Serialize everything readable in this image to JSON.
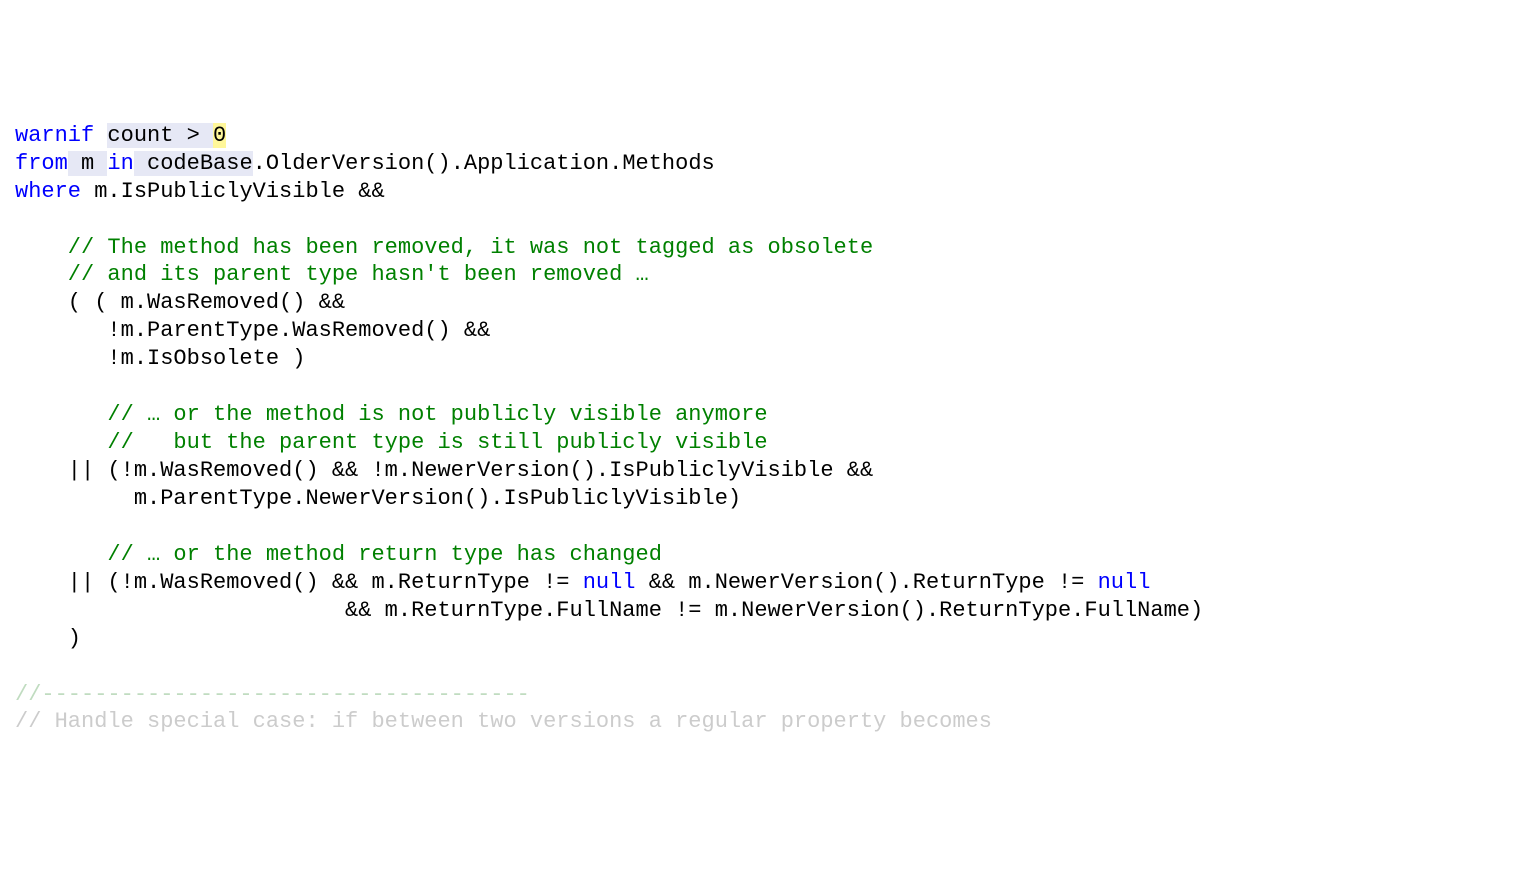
{
  "code": {
    "l01_kw_warnif": "warnif",
    "l01_txt_sp": " ",
    "l01_sel_count": "count ",
    "l01_sel_gt": "> ",
    "l01_hl_zero": "0",
    "l02_kw_from": "from",
    "l02_kw_in": "in",
    "l02_sel_m": " m ",
    "l02_sel_codebase": " codeBase",
    "l02_txt_rest": ".OlderVersion().Application.Methods",
    "l03_kw_where": "where",
    "l03_txt_rest": " m.IsPubliclyVisible &&",
    "l05_cm": "    // The method has been removed, it was not tagged as obsolete",
    "l06_cm": "    // and its parent type hasn't been removed …",
    "l07_txt": "    ( ( m.WasRemoved() && ",
    "l08_txt": "       !m.ParentType.WasRemoved() &&",
    "l09_txt": "       !m.IsObsolete )",
    "l11_cm": "       // … or the method is not publicly visible anymore",
    "l12_cm": "       //   but the parent type is still publicly visible",
    "l13_txt": "    || (!m.WasRemoved() && !m.NewerVersion().IsPubliclyVisible && ",
    "l14_txt": "         m.ParentType.NewerVersion().IsPubliclyVisible)",
    "l16_cm": "       // … or the method return type has changed",
    "l17_txt_a": "    || (!m.WasRemoved() && m.ReturnType != ",
    "l17_kw_null1": "null",
    "l17_txt_b": " && m.NewerVersion().ReturnType != ",
    "l17_kw_null2": "null",
    "l17_txt_c": " ",
    "l18_txt": "                         && m.ReturnType.FullName != m.NewerVersion().ReturnType.FullName)",
    "l19_txt": "    )",
    "l21_cmfade": "//-------------------------------------",
    "l22_fade": "// Handle special case: if between two versions a regular property becomes "
  }
}
